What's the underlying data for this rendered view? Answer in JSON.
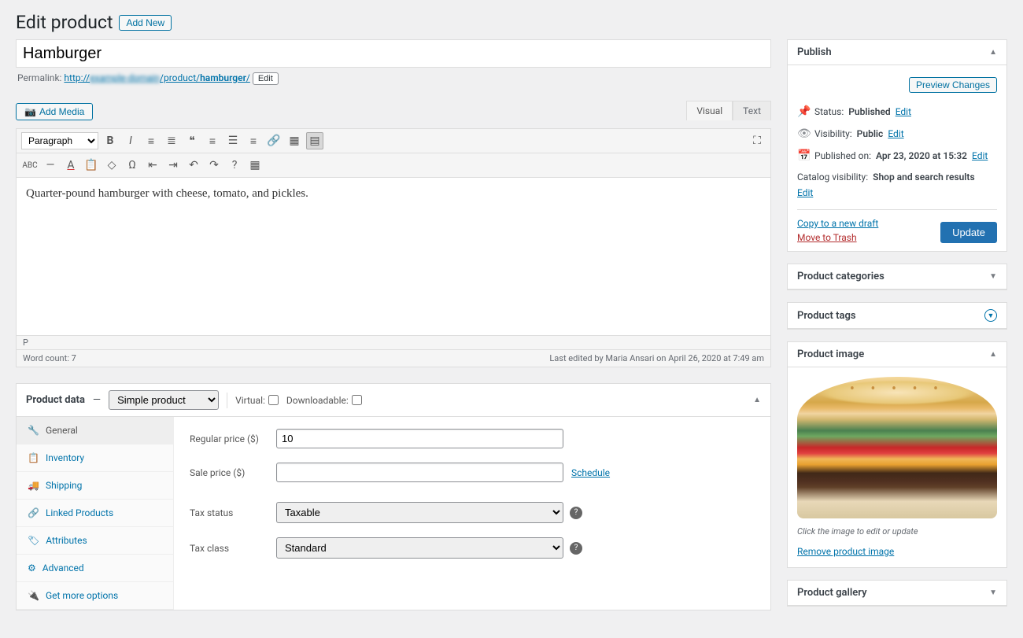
{
  "header": {
    "title": "Edit product",
    "add_new": "Add New"
  },
  "product": {
    "title": "Hamburger",
    "permalink_label": "Permalink:",
    "permalink_base": "http://",
    "permalink_domain": "example-domain",
    "permalink_path": "/product/",
    "permalink_slug": "hamburger",
    "permalink_trail": "/",
    "edit": "Edit",
    "description": "Quarter-pound hamburger with cheese, tomato, and pickles."
  },
  "media": {
    "add_media": "Add Media"
  },
  "tabs": {
    "visual": "Visual",
    "text": "Text"
  },
  "toolbar": {
    "format": "Paragraph"
  },
  "editor_footer": {
    "path": "P",
    "word_count_label": "Word count:",
    "word_count": "7",
    "last_edit": "Last edited by Maria Ansari on April 26, 2020 at 7:49 am"
  },
  "product_data": {
    "title": "Product data",
    "dash": "—",
    "type": "Simple product",
    "virtual": "Virtual:",
    "downloadable": "Downloadable:",
    "tabs": {
      "general": "General",
      "inventory": "Inventory",
      "shipping": "Shipping",
      "linked": "Linked Products",
      "attributes": "Attributes",
      "advanced": "Advanced",
      "more": "Get more options"
    },
    "fields": {
      "regular_price_label": "Regular price ($)",
      "regular_price": "10",
      "sale_price_label": "Sale price ($)",
      "sale_price": "",
      "schedule": "Schedule",
      "tax_status_label": "Tax status",
      "tax_status": "Taxable",
      "tax_class_label": "Tax class",
      "tax_class": "Standard"
    }
  },
  "publish": {
    "title": "Publish",
    "preview": "Preview Changes",
    "status_label": "Status:",
    "status": "Published",
    "visibility_label": "Visibility:",
    "visibility": "Public",
    "published_label": "Published on:",
    "published": "Apr 23, 2020 at 15:32",
    "catalog_label": "Catalog visibility:",
    "catalog": "Shop and search results",
    "edit": "Edit",
    "copy": "Copy to a new draft",
    "trash": "Move to Trash",
    "update": "Update"
  },
  "categories": {
    "title": "Product categories"
  },
  "tags": {
    "title": "Product tags"
  },
  "image": {
    "title": "Product image",
    "caption": "Click the image to edit or update",
    "remove": "Remove product image"
  },
  "gallery": {
    "title": "Product gallery"
  }
}
